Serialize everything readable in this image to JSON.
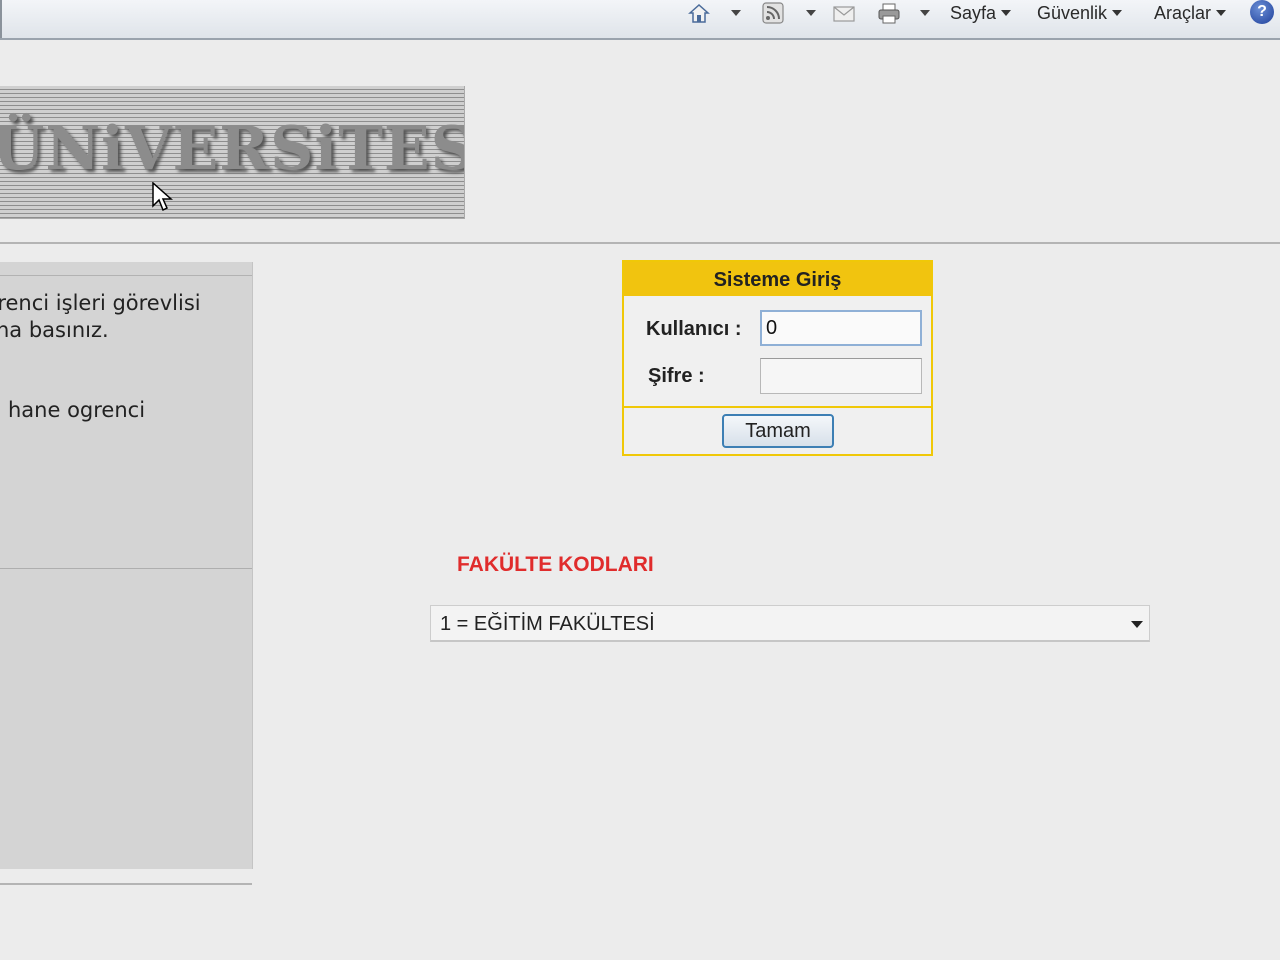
{
  "toolbar": {
    "icons": [
      "home-icon",
      "rss-feed-icon",
      "read-mail-icon",
      "print-icon",
      "help-icon"
    ],
    "menus": [
      "Sayfa",
      "Güvenlik",
      "Araçlar"
    ],
    "help_label": "?"
  },
  "banner": {
    "text": "ÜNiVERSiTESi"
  },
  "left_panel": {
    "line1": "ğrenci işleri görevlisi",
    "line2": "na basınız.",
    "line3": "hane ogrenci"
  },
  "login": {
    "title": "Sisteme Giriş",
    "user_label": "Kullanıcı :",
    "user_value": "0",
    "password_label": "Şifre :",
    "password_value": "",
    "submit_label": "Tamam"
  },
  "faculty": {
    "title": "FAKÜLTE KODLARI",
    "selected": "1 = EĞİTİM FAKÜLTESİ"
  },
  "colors": {
    "login_accent": "#f1c40f",
    "faculty_title": "#e02c2c",
    "button_border": "#3d7fb4"
  }
}
